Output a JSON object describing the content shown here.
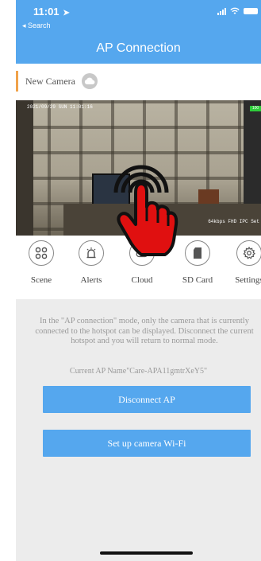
{
  "status_bar": {
    "time": "11:01",
    "back_label": "◂ Search"
  },
  "header": {
    "title": "AP Connection",
    "color": "#55a7ee"
  },
  "camera": {
    "name": "New Camera",
    "timestamp": "2021/09/29  SUN 11:01:16",
    "resolution": "64kbps FHD IPC Set",
    "signal_badge": "100"
  },
  "toolbar": {
    "items": [
      {
        "label": "Scene",
        "icon": "scene-icon"
      },
      {
        "label": "Alerts",
        "icon": "alarm-icon"
      },
      {
        "label": "Cloud",
        "icon": "cloud-icon"
      },
      {
        "label": "SD Card",
        "icon": "sd-card-icon"
      },
      {
        "label": "Settings",
        "icon": "gear-icon"
      }
    ]
  },
  "ap_info": {
    "message": "In the \"AP connection\" mode, only the camera that is currently connected to the hotspot can be displayed. Disconnect the current hotspot and you will return to normal mode.",
    "current_ap": "Current AP Name\"Care-APA11gmtrXeY5\""
  },
  "buttons": {
    "disconnect": "Disconnect AP",
    "setup_wifi": "Set up camera Wi-Fi"
  },
  "overlay": {
    "icon": "tap-hand-icon"
  }
}
